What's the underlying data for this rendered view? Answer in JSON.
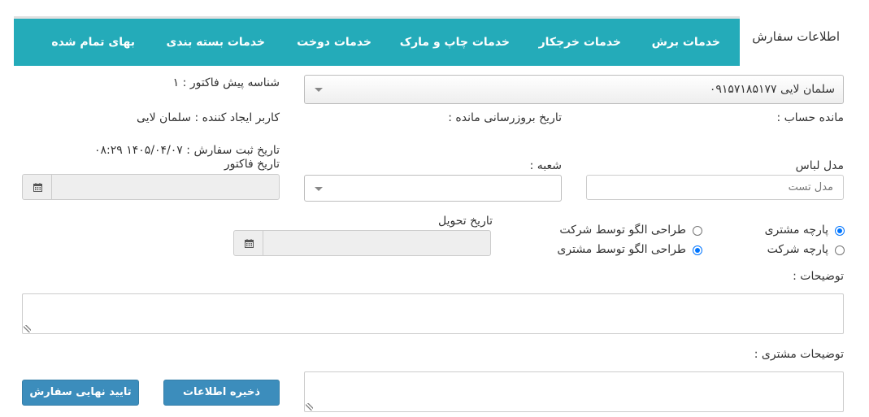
{
  "tabs": [
    {
      "label": "اطلاعات سفارش",
      "active": true
    },
    {
      "label": "خدمات برش"
    },
    {
      "label": "خدمات خرجکار"
    },
    {
      "label": "خدمات چاپ و مارک"
    },
    {
      "label": "خدمات دوخت"
    },
    {
      "label": "خدمات بسته بندی"
    },
    {
      "label": "بهای تمام شده"
    }
  ],
  "customer_select": {
    "value": "سلمان لایی ۰۹۱۵۷۱۸۵۱۷۷"
  },
  "invoice_id": "شناسه پیش فاکتور : ۱",
  "account_balance": "مانده حساب :",
  "balance_update_date": "تاریخ بروزرسانی مانده :",
  "creator": "کاربر ایجاد کننده : سلمان لایی",
  "order_date": "تاریخ ثبت سفارش : ۱۴۰۵/۰۴/۰۷ ۰۸:۲۹",
  "invoice_date_label": "تاریخ فاکتور",
  "model_label": "مدل لباس",
  "model_placeholder": "مدل تست",
  "branch_label": "شعبه :",
  "delivery_date_label": "تاریخ تحویل",
  "radios": {
    "customer_fabric": "پارچه مشتری",
    "company_fabric": "پارچه شرکت",
    "pattern_company": "طراحی الگو توسط شرکت",
    "pattern_customer": "طراحی الگو توسط مشتری"
  },
  "description_label": "توضیحات :",
  "customer_description_label": "توضیحات مشتری :",
  "buttons": {
    "save": "ذخیره اطلاعات",
    "final_confirm": "تایید نهایی سفارش"
  },
  "colors": {
    "tab_bar": "#24abb9",
    "button": "#3c8dbc",
    "radio": "#0075ff"
  }
}
